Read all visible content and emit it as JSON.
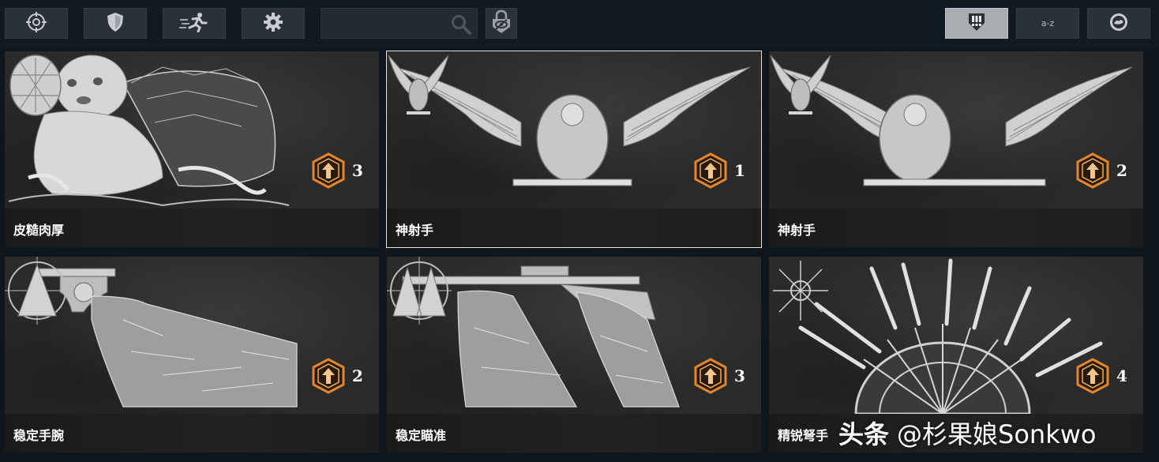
{
  "toolbar": {
    "buttons": [
      {
        "icon": "crosshair-icon"
      },
      {
        "icon": "shield-icon"
      },
      {
        "icon": "running-man-icon"
      },
      {
        "icon": "gear-icon"
      }
    ],
    "search": {
      "value": "",
      "icon": "search-icon"
    },
    "lock_icon": "lock-hidden-icon",
    "sort": {
      "buttons": [
        {
          "icon": "perk-sort-icon",
          "active": true
        },
        {
          "label": "a-z",
          "active": false
        },
        {
          "icon": "badge-sort-icon",
          "active": false
        }
      ]
    }
  },
  "cards": [
    {
      "name": "皮糙肉厚",
      "cost": "3",
      "art": "turtle-man",
      "thumb": "turtle-shell",
      "selected": false
    },
    {
      "name": "神射手",
      "cost": "1",
      "art": "eagle",
      "thumb": "eagle",
      "selected": true
    },
    {
      "name": "神射手",
      "cost": "2",
      "art": "eagle",
      "thumb": "eagle",
      "selected": false
    },
    {
      "name": "稳定手腕",
      "cost": "2",
      "art": "revolver-arm",
      "thumb": "crosshair-peak",
      "selected": false
    },
    {
      "name": "稳定瞄准",
      "cost": "3",
      "art": "rifle-arm",
      "thumb": "twin-peaks",
      "selected": false
    },
    {
      "name": "精锐弩手",
      "cost": "4",
      "art": "crossbow-hands",
      "thumb": "arrow-star",
      "selected": false
    }
  ],
  "watermark": {
    "brand": "头条",
    "handle": "@杉果娘Sonkwo"
  },
  "colors": {
    "accent_orange": "#e2862f",
    "background": "#0f161c",
    "selected_border": "#e4e4e4"
  }
}
